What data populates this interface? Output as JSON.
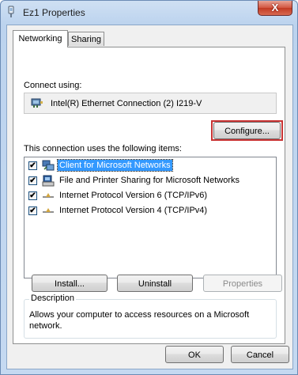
{
  "window": {
    "title": "Ez1 Properties",
    "close_symbol": "X"
  },
  "tabs": [
    {
      "label": "Networking",
      "active": true
    },
    {
      "label": "Sharing",
      "active": false
    }
  ],
  "connect_using": {
    "label": "Connect using:",
    "adapter_name": "Intel(R) Ethernet Connection (2) I219-V",
    "icon": "network-adapter-icon"
  },
  "configure_button": {
    "label": "Configure..."
  },
  "items_section": {
    "label": "This connection uses the following items:",
    "items": [
      {
        "label": "Client for Microsoft Networks",
        "checked": true,
        "selected": true,
        "icon": "client-network-icon"
      },
      {
        "label": "File and Printer Sharing for Microsoft Networks",
        "checked": true,
        "selected": false,
        "icon": "file-printer-sharing-icon"
      },
      {
        "label": "Internet Protocol Version 6 (TCP/IPv6)",
        "checked": true,
        "selected": false,
        "icon": "protocol-icon"
      },
      {
        "label": "Internet Protocol Version 4 (TCP/IPv4)",
        "checked": true,
        "selected": false,
        "icon": "protocol-icon"
      }
    ],
    "check_mark": "✔"
  },
  "action_buttons": {
    "install": "Install...",
    "uninstall": "Uninstall",
    "properties": "Properties"
  },
  "description": {
    "title": "Description",
    "text_line1": "Allows your computer to access resources on a Microsoft",
    "text_line2": "network."
  },
  "footer": {
    "ok": "OK",
    "cancel": "Cancel"
  },
  "colors": {
    "selection": "#3399ff",
    "highlight_outline": "#c83232",
    "title_bar": "#bcd3ee"
  }
}
